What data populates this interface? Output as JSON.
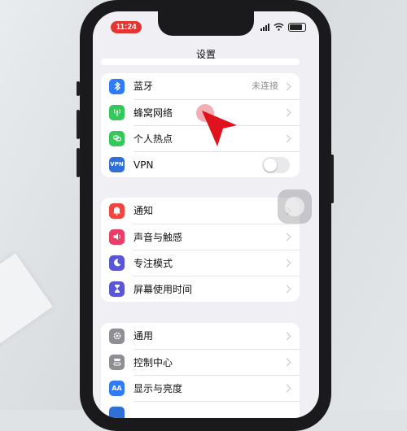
{
  "status_bar": {
    "time": "11:24"
  },
  "header": {
    "title": "设置"
  },
  "group1": [
    {
      "label": "蓝牙",
      "detail": "未连接",
      "icon": "bluetooth-icon",
      "color": "#2f7cf6"
    },
    {
      "label": "蜂窝网络",
      "detail": "",
      "icon": "antenna-icon",
      "color": "#34c759"
    },
    {
      "label": "个人热点",
      "detail": "",
      "icon": "link-icon",
      "color": "#34c759"
    },
    {
      "label": "VPN",
      "detail": "",
      "icon": "vpn-icon",
      "color": "#2f6fd6",
      "icon_text": "VPN",
      "toggle": false
    }
  ],
  "group2": [
    {
      "label": "通知",
      "icon": "bell-icon",
      "color": "#f2453d"
    },
    {
      "label": "声音与触感",
      "icon": "speaker-icon",
      "color": "#ea3e67"
    },
    {
      "label": "专注模式",
      "icon": "moon-icon",
      "color": "#5a57d6"
    },
    {
      "label": "屏幕使用时间",
      "icon": "hourglass-icon",
      "color": "#5a57d6"
    }
  ],
  "group3": [
    {
      "label": "通用",
      "icon": "gear-icon",
      "color": "#8e8e93"
    },
    {
      "label": "控制中心",
      "icon": "switches-icon",
      "color": "#8e8e93"
    },
    {
      "label": "显示与亮度",
      "icon": "aa-icon",
      "color": "#2f7cf6",
      "icon_text": "AA"
    }
  ]
}
